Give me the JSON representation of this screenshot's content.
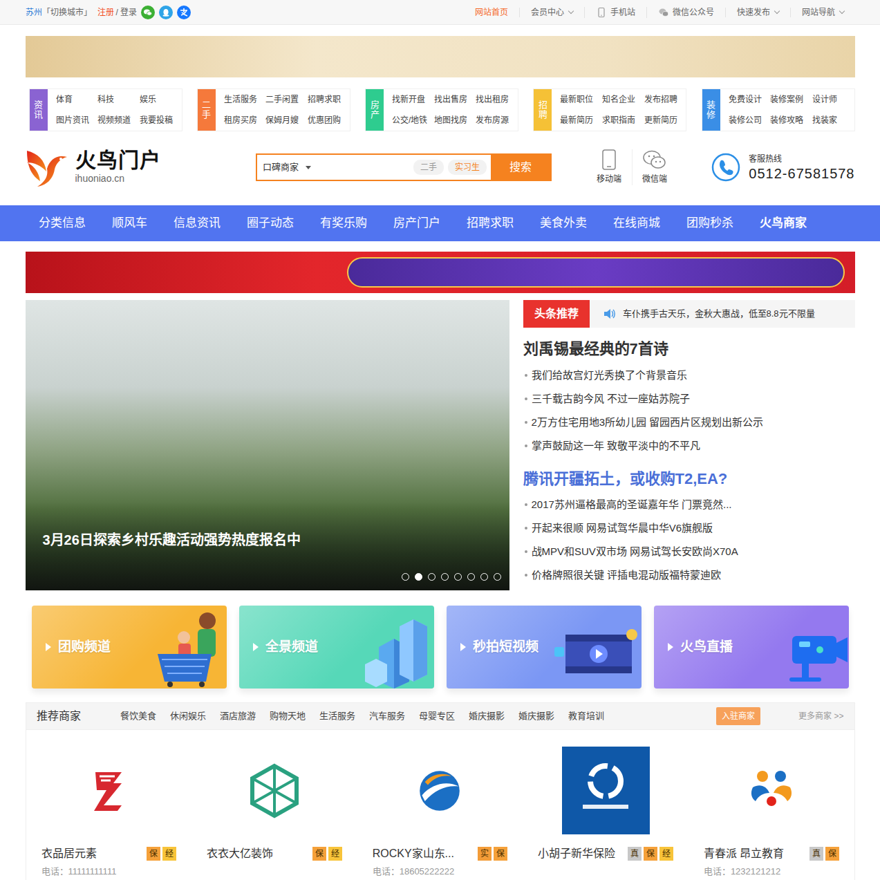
{
  "topbar": {
    "city": "苏州",
    "switch_city": "「切换城市」",
    "register": "注册",
    "separator": "/",
    "login": "登录",
    "links": [
      {
        "label": "网站首页",
        "selected": true,
        "caret": false
      },
      {
        "label": "会员中心",
        "selected": false,
        "caret": true
      },
      {
        "label": "手机站",
        "selected": false,
        "caret": false
      },
      {
        "label": "微信公众号",
        "selected": false,
        "caret": false
      },
      {
        "label": "快速发布",
        "selected": false,
        "caret": true
      },
      {
        "label": "网站导航",
        "selected": false,
        "caret": true
      }
    ]
  },
  "categories": [
    {
      "title": "资讯",
      "color": "#8a63d2",
      "links": [
        "体育",
        "科技",
        "娱乐",
        "图片资讯",
        "视频频道",
        "我要投稿"
      ]
    },
    {
      "title": "二手",
      "color": "#f5793b",
      "links": [
        "生活服务",
        "二手闲置",
        "招聘求职",
        "租房买房",
        "保姆月嫂",
        "优惠团购"
      ]
    },
    {
      "title": "房产",
      "color": "#2ecc8f",
      "links": [
        "找新开盘",
        "找出售房",
        "找出租房",
        "公交/地铁",
        "地图找房",
        "发布房源"
      ]
    },
    {
      "title": "招聘",
      "color": "#f5c136",
      "links": [
        "最新职位",
        "知名企业",
        "发布招聘",
        "最新简历",
        "求职指南",
        "更新简历"
      ]
    },
    {
      "title": "装修",
      "color": "#3a8ee6",
      "links": [
        "免费设计",
        "装修案例",
        "设计师",
        "装修公司",
        "装修攻略",
        "找装家"
      ]
    }
  ],
  "header": {
    "logo": {
      "name": "火鸟门户",
      "domain": "ihuoniao.cn"
    },
    "search": {
      "scope": "口碑商家",
      "tags": [
        {
          "label": "二手",
          "color": "#999999"
        },
        {
          "label": "实习生",
          "color": "#f5821f"
        }
      ],
      "button": "搜索"
    },
    "apps": [
      "移动端",
      "微信端"
    ],
    "hotline": {
      "label": "客服热线",
      "number": "0512-67581578"
    }
  },
  "nav": [
    {
      "label": "分类信息",
      "selected": false
    },
    {
      "label": "顺风车",
      "selected": false
    },
    {
      "label": "信息资讯",
      "selected": false
    },
    {
      "label": "圈子动态",
      "selected": false
    },
    {
      "label": "有奖乐购",
      "selected": false
    },
    {
      "label": "房产门户",
      "selected": false
    },
    {
      "label": "招聘求职",
      "selected": false
    },
    {
      "label": "美食外卖",
      "selected": false
    },
    {
      "label": "在线商城",
      "selected": false
    },
    {
      "label": "团购秒杀",
      "selected": false
    },
    {
      "label": "火鸟商家",
      "selected": true
    }
  ],
  "slider": {
    "caption": "3月26日探索乡村乐趣活动强势热度报名中",
    "slides": [
      {
        "selected": false
      },
      {
        "selected": true
      },
      {
        "selected": false
      },
      {
        "selected": false
      },
      {
        "selected": false
      },
      {
        "selected": false
      },
      {
        "selected": false
      },
      {
        "selected": false
      }
    ]
  },
  "headline": {
    "label": "头条推荐",
    "ticker": "车仆携手古天乐，金秋大惠战，低至8.8元不限量"
  },
  "news": [
    {
      "title": "刘禹锡最经典的7首诗",
      "color": "#333333",
      "items": [
        "我们给故宫灯光秀换了个背景音乐",
        "三千载古韵今风 不过一座姑苏院子",
        "2万方住宅用地3所幼儿园 留园西片区规划出新公示",
        "掌声鼓励这一年 致敬平淡中的不平凡"
      ]
    },
    {
      "title": "腾讯开疆拓土，或收购T2,EA?",
      "color": "#4a6fd8",
      "items": [
        "2017苏州逼格最高的圣诞嘉年华 门票竟然...",
        "开起来很顺 网易试驾华晨中华V6旗舰版",
        "战MPV和SUV双市场 网易试驾长安欧尚X70A",
        "价格牌照很关键 评插电混动版福特蒙迪欧"
      ]
    }
  ],
  "channels": [
    {
      "label": "团购频道",
      "color": "#f7b535"
    },
    {
      "label": "全景频道",
      "color": "#56d8b8"
    },
    {
      "label": "秒拍短视频",
      "color": "#7b97f4"
    },
    {
      "label": "火鸟直播",
      "color": "#9479ef"
    }
  ],
  "merchants": {
    "title": "推荐商家",
    "tabs": [
      "餐饮美食",
      "休闲娱乐",
      "酒店旅游",
      "购物天地",
      "生活服务",
      "汽车服务",
      "母婴专区",
      "婚庆摄影",
      "婚庆摄影",
      "教育培训"
    ],
    "join": "入驻商家",
    "more": "更多商家 >>",
    "items": [
      {
        "name": "衣品居元素",
        "badges": [
          {
            "label": "保",
            "color": "#f5a13a"
          },
          {
            "label": "经",
            "color": "#f8c43a"
          }
        ],
        "phone": "电话：11111111111"
      },
      {
        "name": "衣衣大亿装饰",
        "badges": [
          {
            "label": "保",
            "color": "#f5a13a"
          },
          {
            "label": "经",
            "color": "#f8c43a"
          }
        ]
      },
      {
        "name": "ROCKY家山东...",
        "badges": [
          {
            "label": "实",
            "color": "#f39c38"
          },
          {
            "label": "保",
            "color": "#f5a13a"
          }
        ],
        "phone": "电话：18605222222"
      },
      {
        "name": "小胡子新华保险",
        "badges": [
          {
            "label": "真",
            "color": "#c8c8c8"
          },
          {
            "label": "保",
            "color": "#f5a13a"
          },
          {
            "label": "经",
            "color": "#f8c43a"
          }
        ]
      },
      {
        "name": "青春派 昂立教育",
        "badges": [
          {
            "label": "真",
            "color": "#c8c8c8"
          },
          {
            "label": "保",
            "color": "#f5a13a"
          }
        ],
        "phone": "电话：1232121212"
      }
    ]
  }
}
